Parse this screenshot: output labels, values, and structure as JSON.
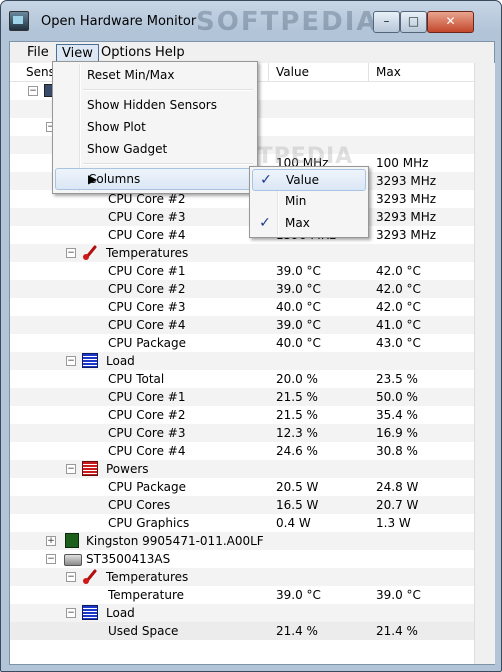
{
  "window": {
    "title": "Open Hardware Monitor",
    "watermark": "SOFTPEDIA",
    "controls": {
      "minimize": "–",
      "maximize": "□",
      "close": "✕"
    }
  },
  "menubar": {
    "file": "File",
    "view": "View",
    "options": "Options",
    "help": "Help"
  },
  "columns": {
    "sensor": "Sensor",
    "value": "Value",
    "max": "Max"
  },
  "view_menu": {
    "reset": "Reset Min/Max",
    "show_hidden": "Show Hidden Sensors",
    "show_plot": "Show Plot",
    "show_gadget": "Show Gadget",
    "columns": "Columns",
    "arrow": "▶"
  },
  "columns_menu": {
    "items": [
      {
        "label": "Value",
        "checked": true
      },
      {
        "label": "Min",
        "checked": false
      },
      {
        "label": "Max",
        "checked": true
      }
    ],
    "checkmark": "✓"
  },
  "background_watermark": "SOFTPEDIA",
  "tree": {
    "expanders": {
      "collapse": "−",
      "expand": "+"
    },
    "partial_rows": [
      {
        "value": "100 MHz",
        "max": "100 MHz"
      },
      {
        "value": "",
        "max": "3293 MHz"
      },
      {
        "name": "CPU Core #2",
        "value": "",
        "max": "3293 MHz"
      },
      {
        "name": "CPU Core #3",
        "value": "",
        "max": "3293 MHz"
      },
      {
        "name": "CPU Core #4",
        "value": "1596 MHz",
        "max": "3293 MHz"
      }
    ],
    "temperatures_label": "Temperatures",
    "temperatures": [
      {
        "name": "CPU Core #1",
        "value": "39.0 °C",
        "max": "42.0 °C"
      },
      {
        "name": "CPU Core #2",
        "value": "39.0 °C",
        "max": "42.0 °C"
      },
      {
        "name": "CPU Core #3",
        "value": "40.0 °C",
        "max": "42.0 °C"
      },
      {
        "name": "CPU Core #4",
        "value": "39.0 °C",
        "max": "41.0 °C"
      },
      {
        "name": "CPU Package",
        "value": "40.0 °C",
        "max": "43.0 °C"
      }
    ],
    "load_label": "Load",
    "load": [
      {
        "name": "CPU Total",
        "value": "20.0 %",
        "max": "23.5 %"
      },
      {
        "name": "CPU Core #1",
        "value": "21.5 %",
        "max": "50.0 %"
      },
      {
        "name": "CPU Core #2",
        "value": "21.5 %",
        "max": "35.4 %"
      },
      {
        "name": "CPU Core #3",
        "value": "12.3 %",
        "max": "16.9 %"
      },
      {
        "name": "CPU Core #4",
        "value": "24.6 %",
        "max": "30.8 %"
      }
    ],
    "powers_label": "Powers",
    "powers": [
      {
        "name": "CPU Package",
        "value": "20.5 W",
        "max": "24.8 W"
      },
      {
        "name": "CPU Cores",
        "value": "16.5 W",
        "max": "20.7 W"
      },
      {
        "name": "CPU Graphics",
        "value": "0.4 W",
        "max": "1.3 W"
      }
    ],
    "ram_label": "Kingston 9905471-011.A00LF",
    "hdd_label": "ST3500413AS",
    "hdd_temperatures_label": "Temperatures",
    "hdd_temperature": {
      "name": "Temperature",
      "value": "39.0 °C",
      "max": "39.0 °C"
    },
    "hdd_load_label": "Load",
    "hdd_used": {
      "name": "Used Space",
      "value": "21.4 %",
      "max": "21.4 %"
    }
  }
}
